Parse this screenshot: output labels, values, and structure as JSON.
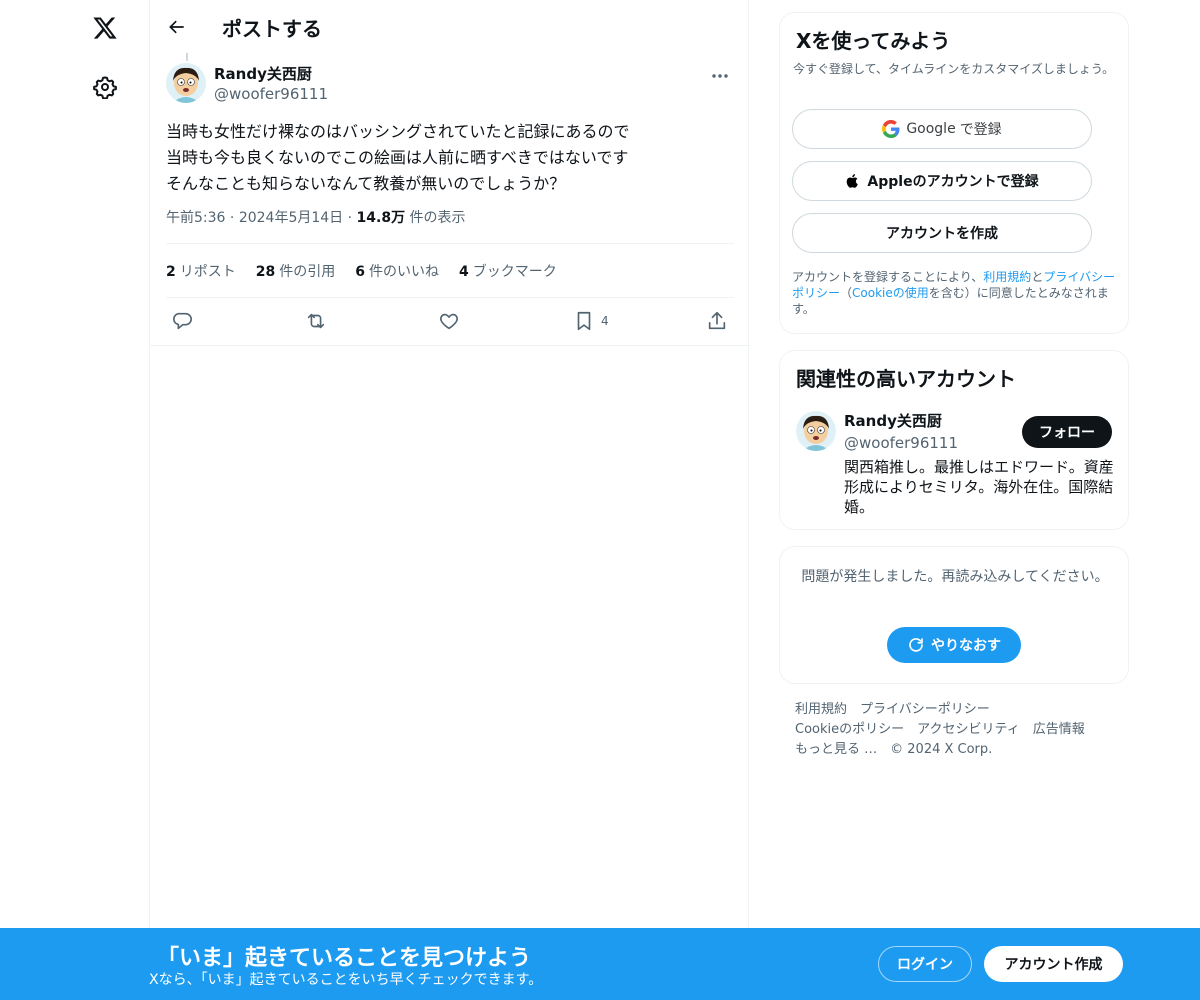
{
  "header": {
    "title": "ポストする"
  },
  "tweet": {
    "author_name": "Randy关西厨",
    "author_handle": "@woofer96111",
    "text_lines": [
      "当時も女性だけ裸なのはバッシングされていたと記録にあるので",
      "当時も今も良くないのでこの絵画は人前に晒すべきではないです",
      "そんなことも知らないなんて教養が無いのでしょうか？"
    ],
    "time": "午前5:36",
    "date": "2024年5月14日",
    "sep": "·",
    "views_count": "14.8万",
    "views_label": "件の表示",
    "stats": [
      {
        "count": "2",
        "label": "リポスト"
      },
      {
        "count": "28",
        "label": "件の引用"
      },
      {
        "count": "6",
        "label": "件のいいね"
      },
      {
        "count": "4",
        "label": "ブックマーク"
      }
    ],
    "bookmark_count": "4"
  },
  "signup": {
    "title": "Xを使ってみよう",
    "subtitle": "今すぐ登録して、タイムラインをカスタマイズしましょう。",
    "google_brand": "Google",
    "google_label": "で登録",
    "apple_label": "Appleのアカウントで登録",
    "create_label": "アカウントを作成",
    "legal_1": "アカウントを登録することにより、",
    "legal_terms": "利用規約",
    "legal_and": "と",
    "legal_privacy": "プライバシーポリシー",
    "legal_open": "（",
    "legal_cookie": "Cookieの使用",
    "legal_2": "を含む）に同意したとみなされます。"
  },
  "related": {
    "title": "関連性の高いアカウント",
    "name": "Randy关西厨",
    "handle": "@woofer96111",
    "follow_label": "フォロー",
    "bio": "関西箱推し。最推しはエドワード。資産形成によりセミリタ。海外在住。国際結婚。"
  },
  "error": {
    "message": "問題が発生しました。再読み込みしてください。",
    "retry_label": "やりなおす"
  },
  "footer": {
    "terms": "利用規約",
    "privacy": "プライバシーポリシー",
    "cookie": "Cookieのポリシー",
    "accessibility": "アクセシビリティ",
    "ads": "広告情報",
    "more": "もっと見る …",
    "copyright": "© 2024 X Corp."
  },
  "banner": {
    "title": "「いま」起きていることを見つけよう",
    "subtitle": "Xなら、「いま」起きていることをいち早くチェックできます。",
    "login_label": "ログイン",
    "create_label": "アカウント作成"
  },
  "colors": {
    "accent": "#1d9bf0",
    "text": "#0f1419",
    "muted": "#536471",
    "border": "#eff3f4"
  }
}
